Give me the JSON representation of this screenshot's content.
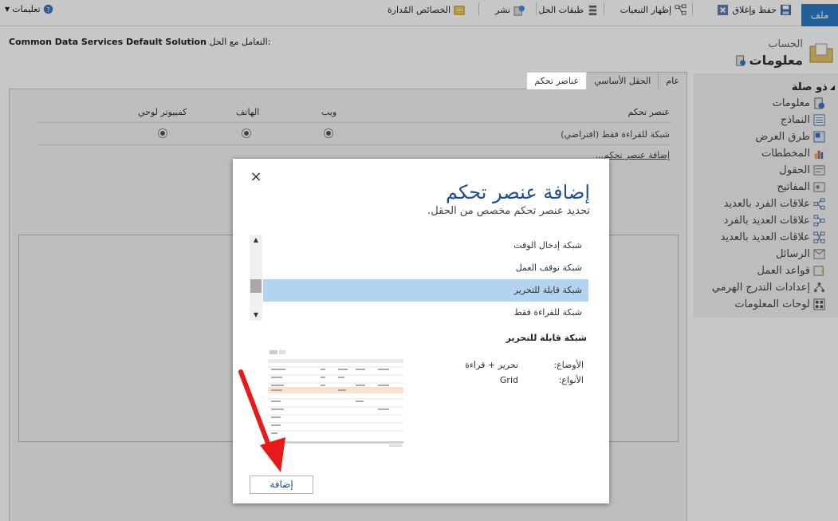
{
  "ribbon": {
    "file": "ملف",
    "save_close": "حفظ وإغلاق",
    "show_dependencies": "إظهار التبعيات",
    "solution_layers": "طبقات الحل",
    "publish": "نشر",
    "managed_properties": "الخصائص المُدارة",
    "help": "تعليمات"
  },
  "header": {
    "solution_prefix": "التعامل مع الحل:",
    "solution_name": "Common Data Services Default Solution",
    "entity_kind": "الحساب",
    "entity_title": "معلومات"
  },
  "nav": {
    "heading": "ذو صلة",
    "items": [
      {
        "label": "معلومات",
        "icon": "info-icon"
      },
      {
        "label": "النماذج",
        "icon": "forms-icon"
      },
      {
        "label": "طرق العرض",
        "icon": "views-icon"
      },
      {
        "label": "المخططات",
        "icon": "charts-icon"
      },
      {
        "label": "الحقول",
        "icon": "fields-icon"
      },
      {
        "label": "المفاتيح",
        "icon": "keys-icon"
      },
      {
        "label": "علاقات الفرد بالعديد",
        "icon": "relationship-icon"
      },
      {
        "label": "علاقات العديد بالفرد",
        "icon": "relationship-icon"
      },
      {
        "label": "علاقات العديد بالعديد",
        "icon": "relationship-icon"
      },
      {
        "label": "الرسائل",
        "icon": "messages-icon"
      },
      {
        "label": "قواعد العمل",
        "icon": "business-rules-icon"
      },
      {
        "label": "إعدادات التدرج الهرمي",
        "icon": "hierarchy-icon"
      },
      {
        "label": "لوحات المعلومات",
        "icon": "dashboards-icon"
      }
    ]
  },
  "tabs": [
    "عام",
    "الحقل الأساسي",
    "عناصر تحكم"
  ],
  "active_tab": "عناصر تحكم",
  "controls_table": {
    "headers": [
      "عنصر تحكم",
      "ويب",
      "الهاتف",
      "كمبيوتر لوحي"
    ],
    "row_label": "شبكة للقراءة فقط (افتراضي)",
    "add_control_link": "إضافة عنصر تحكم..."
  },
  "dialog": {
    "title": "إضافة عنصر تحكم",
    "subtitle": "تحديد عنصر تحكم مخصص من الحقل.",
    "close": "×",
    "options": [
      "شبكة إدخال الوقت",
      "شبكة توقف العمل",
      "شبكة قابلة للتحرير",
      "شبكة للقراءة فقط"
    ],
    "selected_index": 2,
    "detail_name": "شبكة قابلة للتحرير",
    "modes_label": "الأوضاع:",
    "modes_value": "تحرير + قراءة",
    "types_label": "الأنواع:",
    "types_value": "Grid",
    "add_button": "إضافة"
  },
  "colors": {
    "accent": "#2b7bc4",
    "dialog_title": "#1f4e8c",
    "selected_row": "#b3d4f0",
    "annotation_arrow": "#e8191a"
  }
}
